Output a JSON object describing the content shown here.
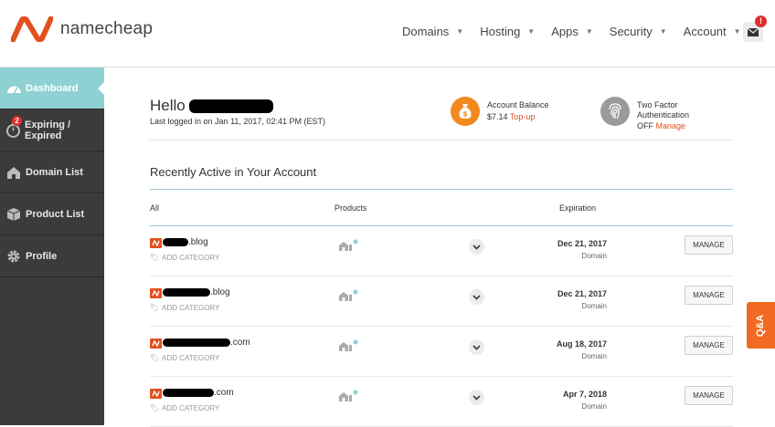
{
  "brand": {
    "name": "namecheap",
    "color": "#e3501f"
  },
  "nav": {
    "items": [
      {
        "label": "Domains"
      },
      {
        "label": "Hosting"
      },
      {
        "label": "Apps"
      },
      {
        "label": "Security"
      },
      {
        "label": "Account"
      }
    ],
    "mail_badge": "!"
  },
  "sidebar": {
    "items": [
      {
        "label": "Dashboard",
        "icon": "speedometer-icon",
        "active": true
      },
      {
        "label": "Expiring / Expired",
        "icon": "timer-icon",
        "badge": "2"
      },
      {
        "label": "Domain List",
        "icon": "house-icon"
      },
      {
        "label": "Product List",
        "icon": "box-icon"
      },
      {
        "label": "Profile",
        "icon": "gear-icon"
      }
    ]
  },
  "welcome": {
    "hello": "Hello",
    "last_login": "Last logged in on Jan 11, 2017, 02:41 PM (EST)"
  },
  "balance": {
    "title": "Account Balance",
    "amount": "$7.14",
    "action": "Top-up"
  },
  "two_factor": {
    "title": "Two Factor Authentication",
    "status": "OFF",
    "action": "Manage"
  },
  "recent": {
    "title": "Recently Active in Your Account",
    "headers": {
      "all": "All",
      "products": "Products",
      "expiration": "Expiration"
    },
    "rows": [
      {
        "suffix": ".blog",
        "add_category": "ADD CATEGORY",
        "date": "Dec 21, 2017",
        "type": "Domain",
        "action": "MANAGE"
      },
      {
        "suffix": ".blog",
        "add_category": "ADD CATEGORY",
        "date": "Dec 21, 2017",
        "type": "Domain",
        "action": "MANAGE"
      },
      {
        "suffix": ".com",
        "add_category": "ADD CATEGORY",
        "date": "Aug 18, 2017",
        "type": "Domain",
        "action": "MANAGE"
      },
      {
        "suffix": ".com",
        "add_category": "ADD CATEGORY",
        "date": "Apr 7, 2018",
        "type": "Domain",
        "action": "MANAGE"
      }
    ]
  },
  "qa_tab": "Q&A"
}
